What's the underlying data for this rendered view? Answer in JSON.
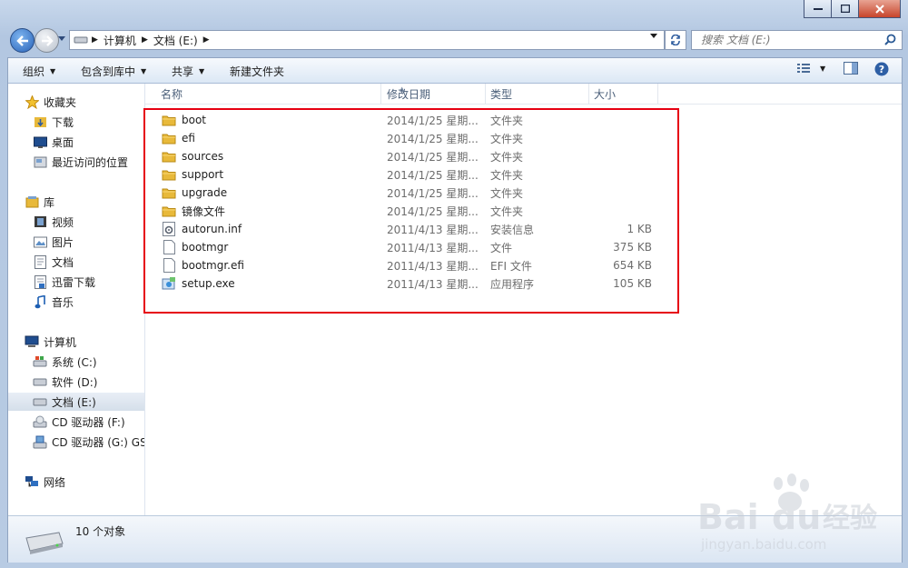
{
  "breadcrumb": {
    "items": [
      "计算机",
      "文档 (E:)"
    ]
  },
  "search": {
    "placeholder": "搜索 文档 (E:)"
  },
  "toolbar": {
    "organize": "组织",
    "include_library": "包含到库中",
    "share": "共享",
    "new_folder": "新建文件夹"
  },
  "nav": {
    "favorites": {
      "label": "收藏夹",
      "items": [
        "下载",
        "桌面",
        "最近访问的位置"
      ]
    },
    "libraries": {
      "label": "库",
      "items": [
        "视频",
        "图片",
        "文档",
        "迅雷下载",
        "音乐"
      ]
    },
    "computer": {
      "label": "计算机",
      "items": [
        "系统 (C:)",
        "软件 (D:)",
        "文档 (E:)",
        "CD 驱动器 (F:)",
        "CD 驱动器 (G:) GSP"
      ]
    },
    "network": {
      "label": "网络"
    }
  },
  "columns": {
    "name": "名称",
    "date": "修改日期",
    "type": "类型",
    "size": "大小"
  },
  "files": [
    {
      "name": "boot",
      "date": "2014/1/25 星期...",
      "type": "文件夹",
      "size": "",
      "icon": "folder-icon"
    },
    {
      "name": "efi",
      "date": "2014/1/25 星期...",
      "type": "文件夹",
      "size": "",
      "icon": "folder-icon"
    },
    {
      "name": "sources",
      "date": "2014/1/25 星期...",
      "type": "文件夹",
      "size": "",
      "icon": "folder-icon"
    },
    {
      "name": "support",
      "date": "2014/1/25 星期...",
      "type": "文件夹",
      "size": "",
      "icon": "folder-icon"
    },
    {
      "name": "upgrade",
      "date": "2014/1/25 星期...",
      "type": "文件夹",
      "size": "",
      "icon": "folder-icon"
    },
    {
      "name": "镜像文件",
      "date": "2014/1/25 星期...",
      "type": "文件夹",
      "size": "",
      "icon": "folder-icon"
    },
    {
      "name": "autorun.inf",
      "date": "2011/4/13 星期...",
      "type": "安装信息",
      "size": "1 KB",
      "icon": "setup-info-icon"
    },
    {
      "name": "bootmgr",
      "date": "2011/4/13 星期...",
      "type": "文件",
      "size": "375 KB",
      "icon": "file-icon"
    },
    {
      "name": "bootmgr.efi",
      "date": "2011/4/13 星期...",
      "type": "EFI 文件",
      "size": "654 KB",
      "icon": "file-icon"
    },
    {
      "name": "setup.exe",
      "date": "2011/4/13 星期...",
      "type": "应用程序",
      "size": "105 KB",
      "icon": "exe-icon"
    }
  ],
  "status": {
    "count": "10 个对象"
  },
  "watermark": {
    "brand": "Bai",
    "brand2": "du",
    "cn": "经验",
    "url": "jingyan.baidu.com"
  },
  "colors": {
    "highlight": "#e60012",
    "folder": "#e8b93a",
    "selection": "#d5dfea"
  }
}
